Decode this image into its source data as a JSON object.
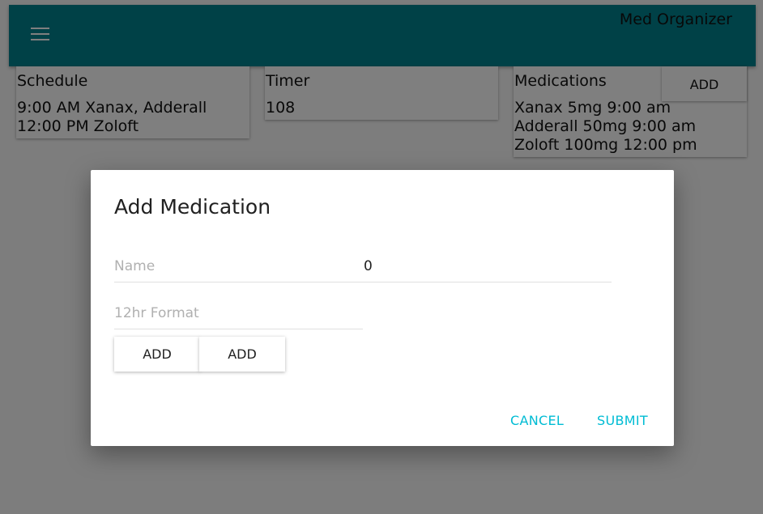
{
  "appbar": {
    "title": "Med Organizer",
    "menu_icon": "hamburger-menu-icon",
    "color": "#00838f"
  },
  "schedule": {
    "title": "Schedule",
    "items": [
      "9:00 AM Xanax, Adderall",
      "12:00 PM Zoloft"
    ]
  },
  "timer": {
    "title": "Timer",
    "value": "108"
  },
  "medications": {
    "title": "Medications",
    "add_label": "ADD",
    "items": [
      "Xanax 5mg 9:00 am",
      "Adderall 50mg 9:00 am",
      "Zoloft 100mg 12:00 pm"
    ]
  },
  "dialog": {
    "title": "Add Medication",
    "name_field": {
      "label": "Name",
      "value": "0"
    },
    "time_field": {
      "label": "12hr Format"
    },
    "add_button_1": "ADD",
    "add_button_2": "ADD",
    "cancel_label": "CANCEL",
    "submit_label": "SUBMIT",
    "action_color": "#00bcd4"
  }
}
